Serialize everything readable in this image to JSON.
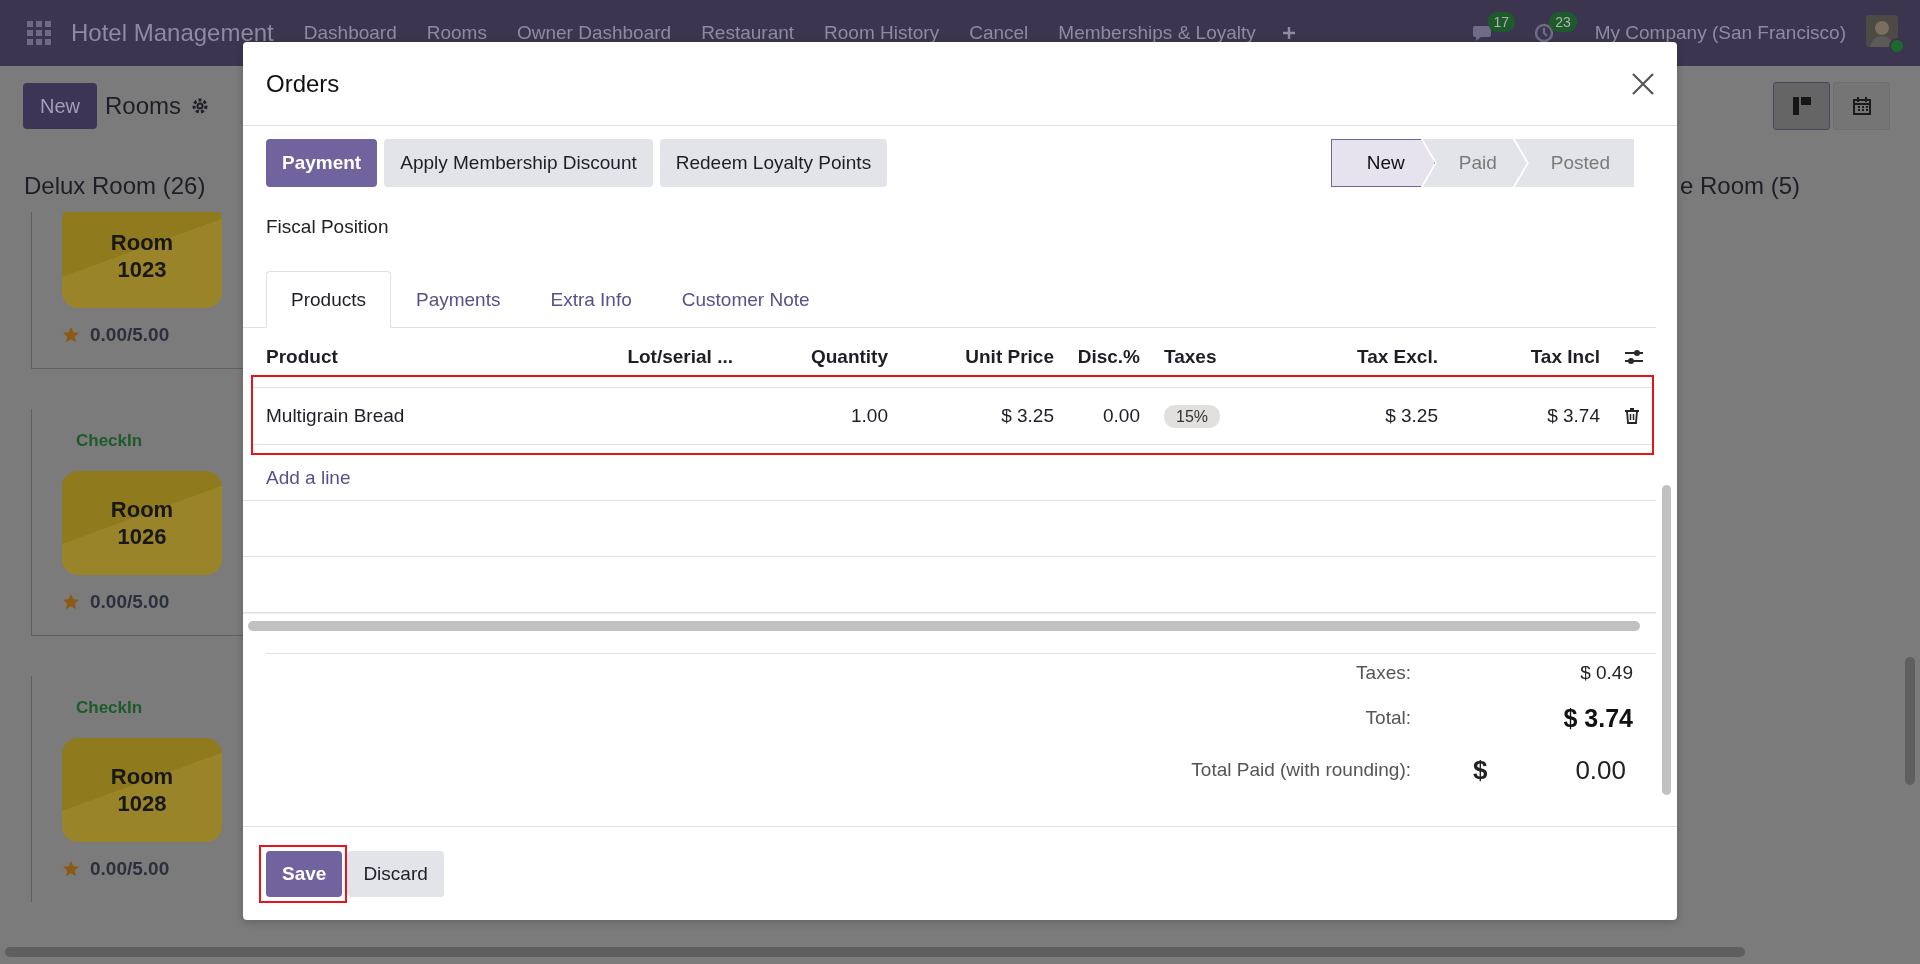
{
  "navbar": {
    "app_name": "Hotel Management",
    "menu": [
      "Dashboard",
      "Rooms",
      "Owner Dashboard",
      "Restaurant",
      "Room History",
      "Cancel",
      "Memberships & Loyalty"
    ],
    "messages_count": "17",
    "activities_count": "23",
    "company": "My Company (San Francisco)"
  },
  "control_panel": {
    "new_button": "New",
    "title": "Rooms",
    "views": [
      {
        "kind": "kanban",
        "selected": true
      },
      {
        "kind": "calendar",
        "selected": false
      }
    ]
  },
  "columns": [
    {
      "title": "Delux Room (26)",
      "cards": [
        {
          "room": "Room 1023",
          "rating": "0.00/5.00"
        },
        {
          "status": "CheckIn",
          "room": "Room 1026",
          "rating": "0.00/5.00"
        },
        {
          "status": "CheckIn",
          "room": "Room 1028",
          "rating": "0.00/5.00"
        }
      ]
    },
    {
      "title": "e Room (5)"
    }
  ],
  "dialog": {
    "title": "Orders",
    "action_buttons": [
      {
        "label": "Payment",
        "kind": "primary"
      },
      {
        "label": "Apply Membership Discount",
        "kind": "secondary"
      },
      {
        "label": "Redeem Loyalty Points",
        "kind": "secondary"
      }
    ],
    "stages": [
      {
        "label": "New",
        "selected": true
      },
      {
        "label": "Paid",
        "selected": false
      },
      {
        "label": "Posted",
        "selected": false
      }
    ],
    "fiscal_position_label": "Fiscal Position",
    "tabs": [
      {
        "label": "Products",
        "selected": true
      },
      {
        "label": "Payments",
        "selected": false
      },
      {
        "label": "Extra Info",
        "selected": false
      },
      {
        "label": "Customer Note",
        "selected": false
      }
    ],
    "table": {
      "columns": [
        {
          "label": "Product",
          "kind": "text"
        },
        {
          "label": "Lot/serial ...",
          "kind": "number"
        },
        {
          "label": "Quantity",
          "kind": "number"
        },
        {
          "label": "Unit Price",
          "kind": "number"
        },
        {
          "label": "Disc.%",
          "kind": "number"
        },
        {
          "label": "Taxes",
          "kind": "tags"
        },
        {
          "label": "Tax Excl.",
          "kind": "number"
        },
        {
          "label": "Tax Incl",
          "kind": "number"
        }
      ],
      "rows": [
        {
          "highlighted": true,
          "cells": [
            "Multigrain Bread",
            null,
            "1.00",
            "$ 3.25",
            "0.00",
            [
              "15%"
            ],
            "$ 3.25",
            "$ 3.74"
          ]
        }
      ],
      "add_line": "Add a line"
    },
    "totals": [
      {
        "kind": "plain",
        "label": "Taxes:",
        "value": "$ 0.49"
      },
      {
        "kind": "bold",
        "label": "Total:",
        "value": "$ 3.74"
      },
      {
        "kind": "currency",
        "label": "Total Paid (with rounding):",
        "currency": "$",
        "value": "0.00"
      }
    ],
    "footer_buttons": [
      {
        "label": "Save",
        "kind": "primary",
        "highlighted": true
      },
      {
        "label": "Discard",
        "kind": "secondary",
        "highlighted": false
      }
    ]
  }
}
